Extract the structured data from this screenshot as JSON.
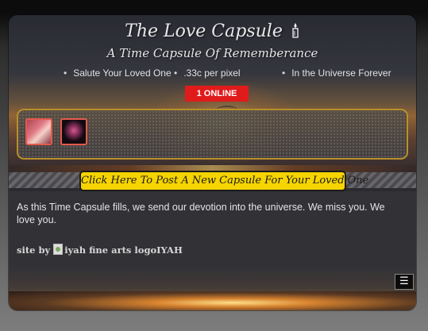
{
  "header": {
    "title": "The Love Capsule",
    "title_icon": "candle-icon",
    "subtitle": "A Time Capsule Of Rememberance"
  },
  "bullets": [
    "Salute Your Loved One",
    ".33c per pixel",
    "In the Universe Forever"
  ],
  "online_badge": "1 ONLINE",
  "capsules": [
    {
      "name": "capsule-thumbnail-1"
    },
    {
      "name": "capsule-thumbnail-2"
    }
  ],
  "post_button": "Click Here To Post A New Capsule For Your Loved One",
  "description": "As this Time Capsule fills, we send our devotion into the universe. We miss you. We love you.",
  "credit": {
    "prefix": "site by",
    "logo_alt": "iyah fine arts logo",
    "name": "IYAH"
  },
  "menu_button": "☰",
  "colors": {
    "online_badge": "#e01b1b",
    "post_button": "#f5d400",
    "panel_border": "#b8902c",
    "thumb_border": "#e25a4c"
  }
}
